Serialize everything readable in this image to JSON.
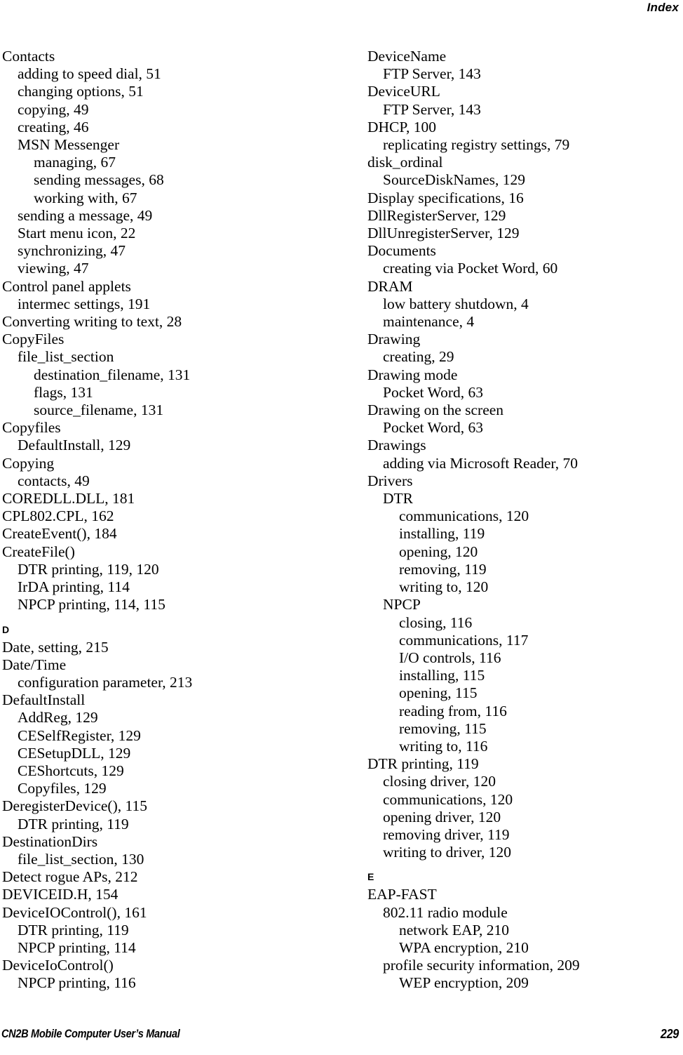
{
  "header": {
    "title": "Index"
  },
  "footer": {
    "manual_title": "CN2B Mobile Computer User’s Manual",
    "page_number": "229"
  },
  "columns": {
    "left": [
      {
        "type": "entry",
        "level": 0,
        "text": "Contacts"
      },
      {
        "type": "entry",
        "level": 1,
        "text": "adding to speed dial, 51"
      },
      {
        "type": "entry",
        "level": 1,
        "text": "changing options, 51"
      },
      {
        "type": "entry",
        "level": 1,
        "text": "copying, 49"
      },
      {
        "type": "entry",
        "level": 1,
        "text": "creating, 46"
      },
      {
        "type": "entry",
        "level": 1,
        "text": "MSN Messenger"
      },
      {
        "type": "entry",
        "level": 2,
        "text": "managing, 67"
      },
      {
        "type": "entry",
        "level": 2,
        "text": "sending messages, 68"
      },
      {
        "type": "entry",
        "level": 2,
        "text": "working with, 67"
      },
      {
        "type": "entry",
        "level": 1,
        "text": "sending a message, 49"
      },
      {
        "type": "entry",
        "level": 1,
        "text": "Start menu icon, 22"
      },
      {
        "type": "entry",
        "level": 1,
        "text": "synchronizing, 47"
      },
      {
        "type": "entry",
        "level": 1,
        "text": "viewing, 47"
      },
      {
        "type": "entry",
        "level": 0,
        "text": "Control panel applets"
      },
      {
        "type": "entry",
        "level": 1,
        "text": "intermec settings, 191"
      },
      {
        "type": "entry",
        "level": 0,
        "text": "Converting writing to text, 28"
      },
      {
        "type": "entry",
        "level": 0,
        "text": "CopyFiles"
      },
      {
        "type": "entry",
        "level": 1,
        "text": "file_list_section"
      },
      {
        "type": "entry",
        "level": 2,
        "text": "destination_filename, 131"
      },
      {
        "type": "entry",
        "level": 2,
        "text": "flags, 131"
      },
      {
        "type": "entry",
        "level": 2,
        "text": "source_filename, 131"
      },
      {
        "type": "entry",
        "level": 0,
        "text": "Copyfiles"
      },
      {
        "type": "entry",
        "level": 1,
        "text": "DefaultInstall, 129"
      },
      {
        "type": "entry",
        "level": 0,
        "text": "Copying"
      },
      {
        "type": "entry",
        "level": 1,
        "text": "contacts, 49"
      },
      {
        "type": "entry",
        "level": 0,
        "text": "COREDLL.DLL, 181"
      },
      {
        "type": "entry",
        "level": 0,
        "text": "CPL802.CPL, 162"
      },
      {
        "type": "entry",
        "level": 0,
        "text": "CreateEvent(), 184"
      },
      {
        "type": "entry",
        "level": 0,
        "text": "CreateFile()"
      },
      {
        "type": "entry",
        "level": 1,
        "text": "DTR printing, 119, 120"
      },
      {
        "type": "entry",
        "level": 1,
        "text": "IrDA printing, 114"
      },
      {
        "type": "entry",
        "level": 1,
        "text": "NPCP printing, 114, 115"
      },
      {
        "type": "heading",
        "level": 0,
        "text": "D"
      },
      {
        "type": "entry",
        "level": 0,
        "text": "Date, setting, 215"
      },
      {
        "type": "entry",
        "level": 0,
        "text": "Date/Time"
      },
      {
        "type": "entry",
        "level": 1,
        "text": "configuration parameter, 213"
      },
      {
        "type": "entry",
        "level": 0,
        "text": "DefaultInstall"
      },
      {
        "type": "entry",
        "level": 1,
        "text": "AddReg, 129"
      },
      {
        "type": "entry",
        "level": 1,
        "text": "CESelfRegister, 129"
      },
      {
        "type": "entry",
        "level": 1,
        "text": "CESetupDLL, 129"
      },
      {
        "type": "entry",
        "level": 1,
        "text": "CEShortcuts, 129"
      },
      {
        "type": "entry",
        "level": 1,
        "text": "Copyfiles, 129"
      },
      {
        "type": "entry",
        "level": 0,
        "text": "DeregisterDevice(), 115"
      },
      {
        "type": "entry",
        "level": 1,
        "text": "DTR printing, 119"
      },
      {
        "type": "entry",
        "level": 0,
        "text": "DestinationDirs"
      },
      {
        "type": "entry",
        "level": 1,
        "text": "file_list_section, 130"
      },
      {
        "type": "entry",
        "level": 0,
        "text": "Detect rogue APs, 212"
      },
      {
        "type": "entry",
        "level": 0,
        "text": "DEVICEID.H, 154"
      },
      {
        "type": "entry",
        "level": 0,
        "text": "DeviceIOControl(), 161"
      },
      {
        "type": "entry",
        "level": 1,
        "text": "DTR printing, 119"
      },
      {
        "type": "entry",
        "level": 1,
        "text": "NPCP printing, 114"
      },
      {
        "type": "entry",
        "level": 0,
        "text": "DeviceIoControl()"
      },
      {
        "type": "entry",
        "level": 1,
        "text": "NPCP printing, 116"
      }
    ],
    "right": [
      {
        "type": "entry",
        "level": 0,
        "text": "DeviceName"
      },
      {
        "type": "entry",
        "level": 1,
        "text": "FTP Server, 143"
      },
      {
        "type": "entry",
        "level": 0,
        "text": "DeviceURL"
      },
      {
        "type": "entry",
        "level": 1,
        "text": "FTP Server, 143"
      },
      {
        "type": "entry",
        "level": 0,
        "text": "DHCP, 100"
      },
      {
        "type": "entry",
        "level": 1,
        "text": "replicating registry settings, 79"
      },
      {
        "type": "entry",
        "level": 0,
        "text": "disk_ordinal"
      },
      {
        "type": "entry",
        "level": 1,
        "text": "SourceDiskNames, 129"
      },
      {
        "type": "entry",
        "level": 0,
        "text": "Display specifications, 16"
      },
      {
        "type": "entry",
        "level": 0,
        "text": "DllRegisterServer, 129"
      },
      {
        "type": "entry",
        "level": 0,
        "text": "DllUnregisterServer, 129"
      },
      {
        "type": "entry",
        "level": 0,
        "text": "Documents"
      },
      {
        "type": "entry",
        "level": 1,
        "text": "creating via Pocket Word, 60"
      },
      {
        "type": "entry",
        "level": 0,
        "text": "DRAM"
      },
      {
        "type": "entry",
        "level": 1,
        "text": "low battery shutdown, 4"
      },
      {
        "type": "entry",
        "level": 1,
        "text": "maintenance, 4"
      },
      {
        "type": "entry",
        "level": 0,
        "text": "Drawing"
      },
      {
        "type": "entry",
        "level": 1,
        "text": "creating, 29"
      },
      {
        "type": "entry",
        "level": 0,
        "text": "Drawing mode"
      },
      {
        "type": "entry",
        "level": 1,
        "text": "Pocket Word, 63"
      },
      {
        "type": "entry",
        "level": 0,
        "text": "Drawing on the screen"
      },
      {
        "type": "entry",
        "level": 1,
        "text": "Pocket Word, 63"
      },
      {
        "type": "entry",
        "level": 0,
        "text": "Drawings"
      },
      {
        "type": "entry",
        "level": 1,
        "text": "adding via Microsoft Reader, 70"
      },
      {
        "type": "entry",
        "level": 0,
        "text": "Drivers"
      },
      {
        "type": "entry",
        "level": 1,
        "text": "DTR"
      },
      {
        "type": "entry",
        "level": 2,
        "text": "communications, 120"
      },
      {
        "type": "entry",
        "level": 2,
        "text": "installing, 119"
      },
      {
        "type": "entry",
        "level": 2,
        "text": "opening, 120"
      },
      {
        "type": "entry",
        "level": 2,
        "text": "removing, 119"
      },
      {
        "type": "entry",
        "level": 2,
        "text": "writing to, 120"
      },
      {
        "type": "entry",
        "level": 1,
        "text": "NPCP"
      },
      {
        "type": "entry",
        "level": 2,
        "text": "closing, 116"
      },
      {
        "type": "entry",
        "level": 2,
        "text": "communications, 117"
      },
      {
        "type": "entry",
        "level": 2,
        "text": "I/O controls, 116"
      },
      {
        "type": "entry",
        "level": 2,
        "text": "installing, 115"
      },
      {
        "type": "entry",
        "level": 2,
        "text": "opening, 115"
      },
      {
        "type": "entry",
        "level": 2,
        "text": "reading from, 116"
      },
      {
        "type": "entry",
        "level": 2,
        "text": "removing, 115"
      },
      {
        "type": "entry",
        "level": 2,
        "text": "writing to, 116"
      },
      {
        "type": "entry",
        "level": 0,
        "text": "DTR printing, 119"
      },
      {
        "type": "entry",
        "level": 1,
        "text": "closing driver, 120"
      },
      {
        "type": "entry",
        "level": 1,
        "text": "communications, 120"
      },
      {
        "type": "entry",
        "level": 1,
        "text": "opening driver, 120"
      },
      {
        "type": "entry",
        "level": 1,
        "text": "removing driver, 119"
      },
      {
        "type": "entry",
        "level": 1,
        "text": "writing to driver, 120"
      },
      {
        "type": "heading",
        "level": 0,
        "text": "E"
      },
      {
        "type": "entry",
        "level": 0,
        "text": "EAP-FAST"
      },
      {
        "type": "entry",
        "level": 1,
        "text": "802.11 radio module"
      },
      {
        "type": "entry",
        "level": 2,
        "text": "network EAP, 210"
      },
      {
        "type": "entry",
        "level": 2,
        "text": "WPA encryption, 210"
      },
      {
        "type": "entry",
        "level": 1,
        "text": "profile security information, 209"
      },
      {
        "type": "entry",
        "level": 2,
        "text": "WEP encryption, 209"
      }
    ]
  }
}
